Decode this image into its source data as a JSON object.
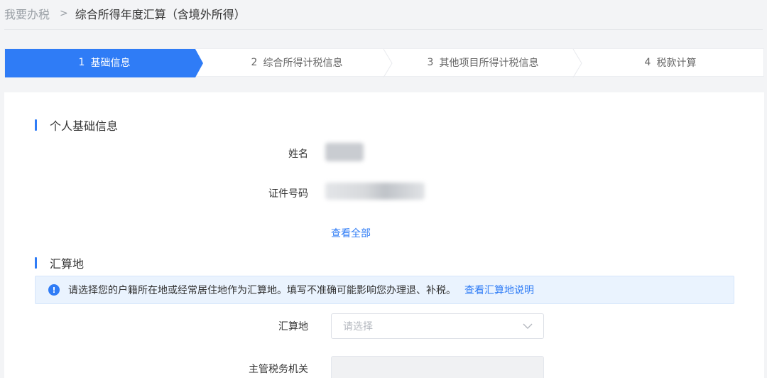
{
  "breadcrumb": {
    "home": "我要办税",
    "separator": ">",
    "current": "综合所得年度汇算（含境外所得）"
  },
  "steps": [
    {
      "num": "1",
      "label": "基础信息",
      "active": true
    },
    {
      "num": "2",
      "label": "综合所得计税信息",
      "active": false
    },
    {
      "num": "3",
      "label": "其他项目所得计税信息",
      "active": false
    },
    {
      "num": "4",
      "label": "税款计算",
      "active": false
    }
  ],
  "personal": {
    "title": "个人基础信息",
    "name_label": "姓名",
    "id_label": "证件号码",
    "view_all": "查看全部"
  },
  "settlement": {
    "title": "汇算地",
    "notice_text": "请选择您的户籍所在地或经常居住地作为汇算地。填写不准确可能影响您办理退、补税。",
    "notice_link": "查看汇算地说明",
    "field_label": "汇算地",
    "field_placeholder": "请选择",
    "authority_label": "主管税务机关"
  },
  "colors": {
    "accent": "#2f7cf6",
    "notice_bg": "#eaf3fe"
  },
  "icons": {
    "notice": "info-circle-icon",
    "select": "chevron-down-icon"
  }
}
